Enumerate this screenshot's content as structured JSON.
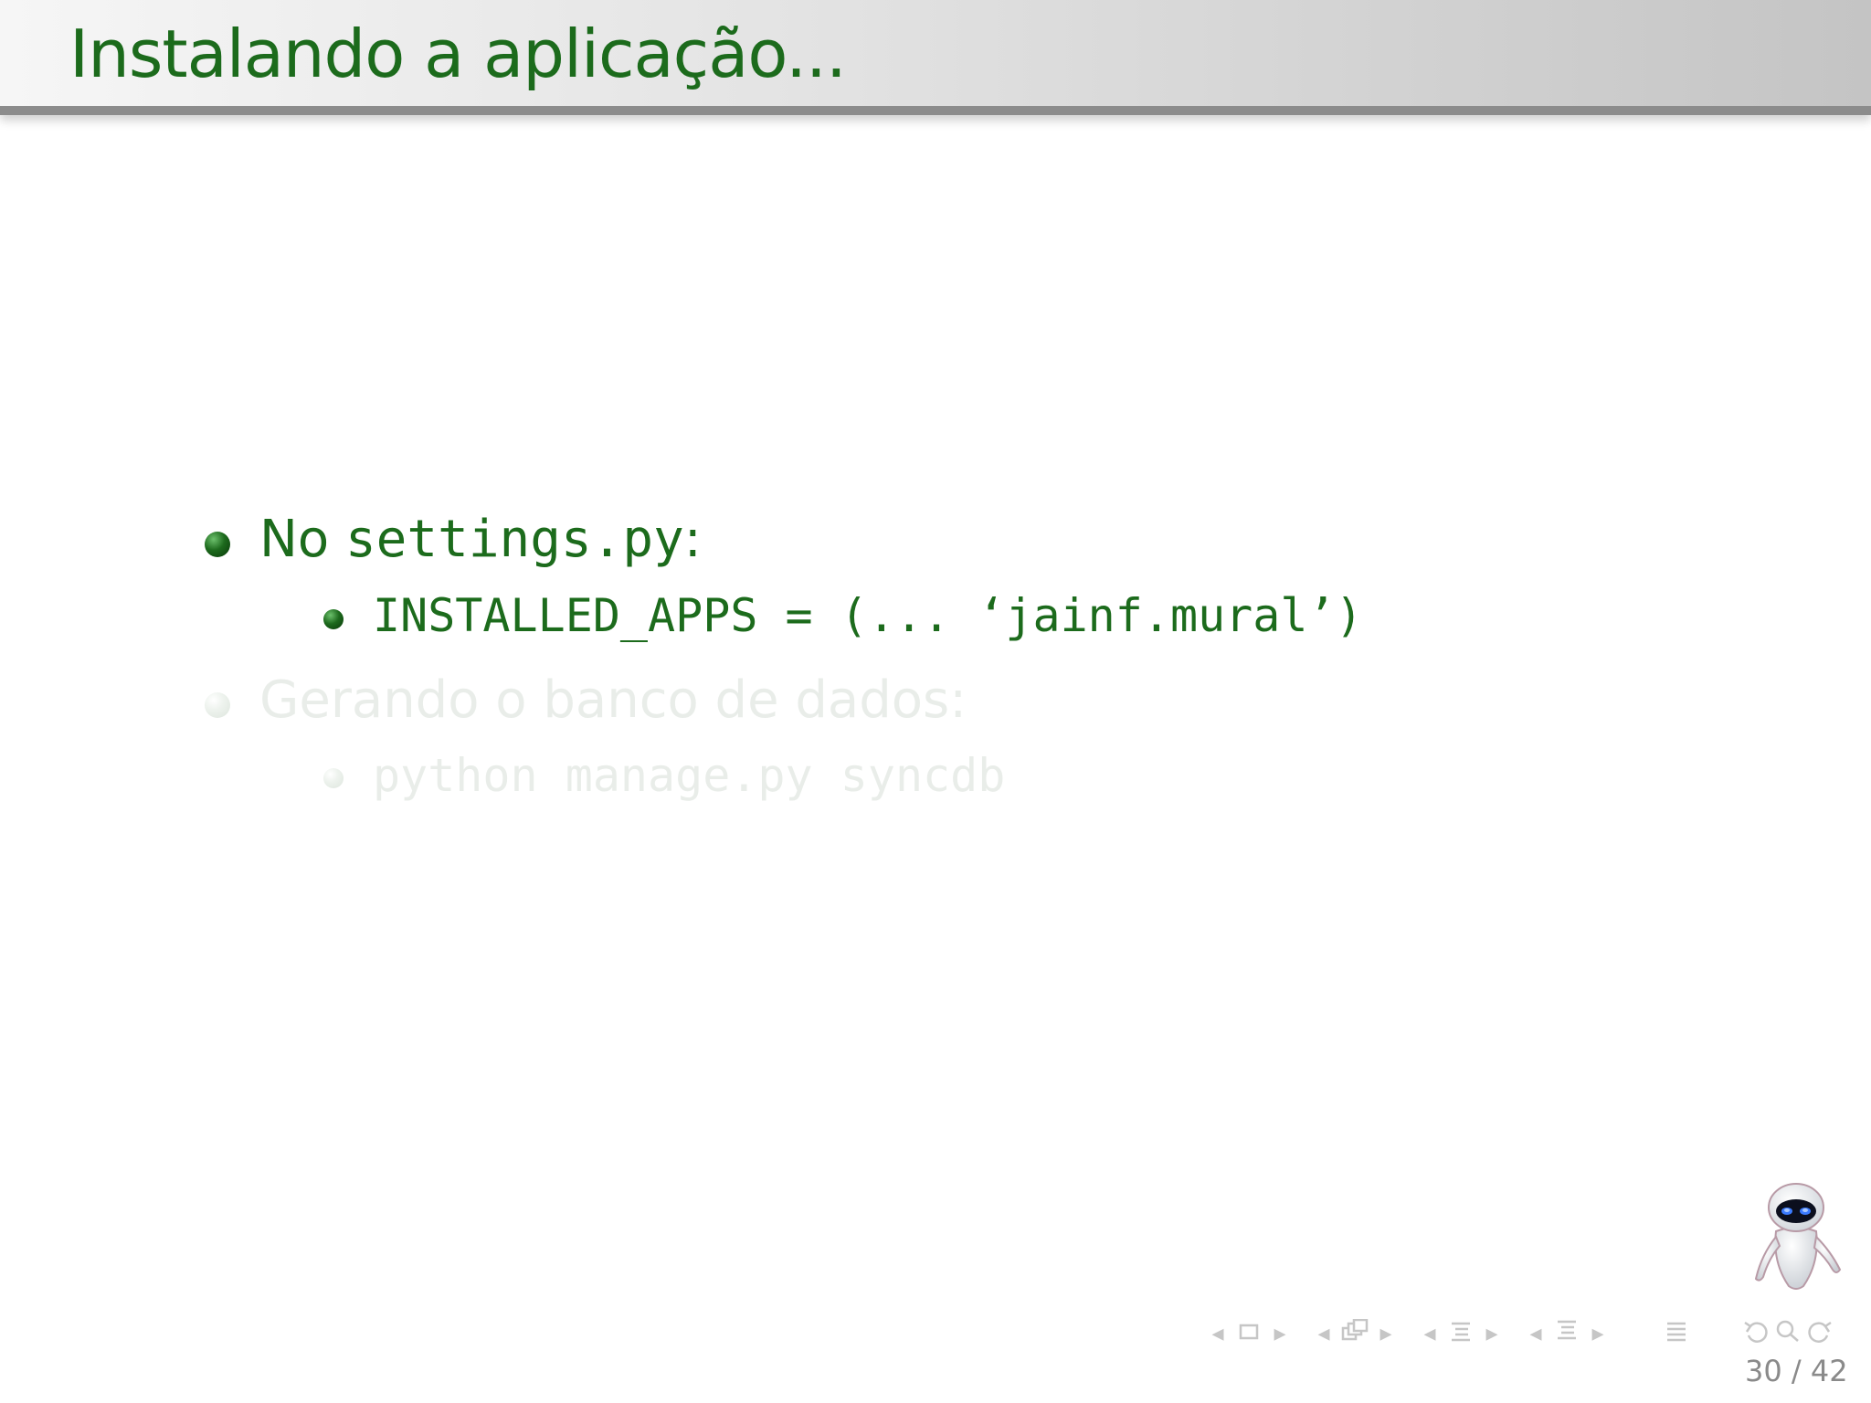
{
  "slide": {
    "title": "Instalando a aplicação..."
  },
  "items": [
    {
      "prefix": "No ",
      "code": "settings.py",
      "suffix": ":",
      "sub": "INSTALLED_APPS = (...  ‘jainf.mural’)"
    },
    {
      "text": "Gerando o banco de dados:",
      "sub": "python manage.py syncdb"
    }
  ],
  "navigation": {
    "prev_glyph": "◂",
    "next_glyph": "▸",
    "frame_icon": "frame-icon",
    "subsection_icon": "subsection-icon",
    "section_icon": "section-icon",
    "document_icon": "document-icon",
    "undo_icon": "undo-icon",
    "search_icon": "search-icon",
    "redo_icon": "redo-icon"
  },
  "page": {
    "current": "30",
    "total": "42",
    "separator": " / "
  },
  "colors": {
    "title_green": "#1c6b1c",
    "faded_text": "#e9ede9",
    "nav_gray": "#c6c6c6"
  }
}
